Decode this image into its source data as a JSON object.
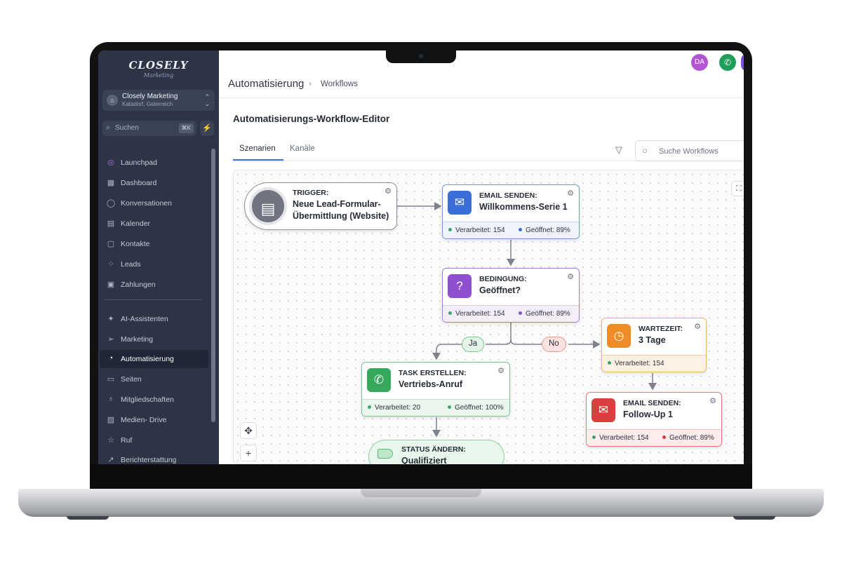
{
  "sidebar": {
    "logo": "CLOSELY",
    "logo_sub": "Marketing",
    "account": {
      "initial": "⌂",
      "name": "Closely Marketing",
      "location": "Katadorf, Gaterreich"
    },
    "search": {
      "placeholder": "Suchen",
      "shortcut": "⌘K"
    },
    "items": [
      {
        "label": "Launchpad",
        "icon": "launchpad-icon"
      },
      {
        "label": "Dashboard",
        "icon": "dashboard-icon"
      },
      {
        "label": "Konversationen",
        "icon": "chat-icon"
      },
      {
        "label": "Kalender",
        "icon": "calendar-icon"
      },
      {
        "label": "Kontakte",
        "icon": "contacts-icon"
      },
      {
        "label": "Leads",
        "icon": "leads-icon"
      },
      {
        "label": "Zahlungen",
        "icon": "payments-icon"
      },
      {
        "label": "AI-Assistenten",
        "icon": "sparkle-icon"
      },
      {
        "label": "Marketing",
        "icon": "send-icon"
      },
      {
        "label": "Automatisierung",
        "icon": "automation-icon",
        "active": true
      },
      {
        "label": "Seiten",
        "icon": "pages-icon"
      },
      {
        "label": "Mitgliedschaften",
        "icon": "badge-icon"
      },
      {
        "label": "Medien- Drive",
        "icon": "media-icon"
      },
      {
        "label": "Ruf",
        "icon": "star-icon"
      },
      {
        "label": "Berichterstattung",
        "icon": "chart-icon"
      }
    ]
  },
  "header": {
    "breadcrumb": [
      "Automatisierung",
      "Workflows"
    ],
    "avatar_initials": "DA",
    "avatar_color": "#b455d6",
    "phone_color": "#1f9d5a"
  },
  "editor": {
    "title": "Automatisierungs-Workflow-Editor",
    "tabs": [
      "Szenarien",
      "Kanäle"
    ],
    "active_tab": "Szenarien",
    "search_placeholder": "Suche Workflows"
  },
  "workflow": {
    "trigger": {
      "kind": "TRIGGER:",
      "label": "Neue Lead-Formular-Übermittlung (Website)"
    },
    "email1": {
      "kind": "EMAIL SENDEN:",
      "label": "Willkommens-Serie 1",
      "processed": "Verarbeitet: 154",
      "opened": "Geöffnet: 89%",
      "color": "#3b6fd8"
    },
    "condition": {
      "kind": "BEDINGUNG:",
      "label": "Geöffnet?",
      "processed": "Verarbeitet: 154",
      "opened": "Geöffnet: 89%",
      "color": "#8e4fd1"
    },
    "branch_yes": "Ja",
    "branch_no": "No",
    "wait": {
      "kind": "WARTEZEIT:",
      "label": "3 Tage",
      "processed": "Verarbeitet: 154",
      "color": "#f08c28"
    },
    "task": {
      "kind": "TASK ERSTELLEN:",
      "label": "Vertriebs-Anruf",
      "processed": "Verarbeitet: 20",
      "opened": "Geöffnet: 100%",
      "color": "#35a85c"
    },
    "email2": {
      "kind": "EMAIL SENDEN:",
      "label": "Follow-Up 1",
      "processed": "Verarbeitet: 154",
      "opened": "Geöffnet: 89%",
      "color": "#d84040"
    },
    "status": {
      "kind": "STATUS ÄNDERN:",
      "label": "Qualifiziert"
    }
  }
}
